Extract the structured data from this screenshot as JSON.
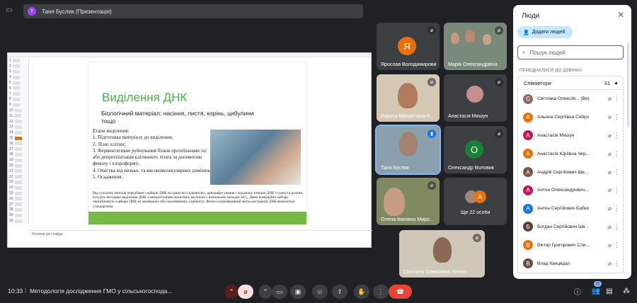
{
  "presenter_chip": {
    "initial": "Т",
    "label": "Таня Буслик (Презентація)"
  },
  "slide": {
    "title": "Виділення ДНК",
    "subtitle": "Біологічний матеріал: насіння, листя, корінь, цибулини тощо",
    "steps": [
      "Етапи виділення:",
      "1. Підготовка матеріалу до виділення;",
      "2. Лізис клітин;",
      "3. Ферментативне руйнування білків протеїназами та/або депротеїнізація клітинного лізата за допомогою фенолу і хлороформу;",
      "4. Очистка від низько- та високомолекулярних домішок;",
      "5. Осадження."
    ],
    "body": "Ряд сучасних методів передбачає сорбцію ДНК на гранулах силікагелю , центрифугування і подальшу елюцію ДНК з гранул в розчин. Існують методики виділення ДНК з використанням магнітних частинок з напиленим оксидом SiO₂. Деякі комерційні набори передбачають сорбцію ДНК на мембранах або іонообмінних сорбентах. Фенол-хлороформний метод екстракції ДНК вважається стандартним.",
    "notes_placeholder": "Нотатки до слайда",
    "thumb_numbers": [
      "1",
      "2",
      "3",
      "4",
      "5",
      "6",
      "7",
      "8",
      "9",
      "10",
      "11",
      "12",
      "13",
      "14",
      "15",
      "16",
      "17",
      "18",
      "19",
      "20",
      "21",
      "22",
      "23",
      "24",
      "25",
      "26",
      "27",
      "28",
      "29",
      "30"
    ]
  },
  "tiles": [
    {
      "name": "Ярослав Володимирович",
      "initial": "Я",
      "avatar_color": "#e8710a"
    },
    {
      "name": "Марія Олександрівна"
    },
    {
      "name": "Лариса Михайлівна К..."
    },
    {
      "name": "Анастасія Мишун"
    },
    {
      "name": "Таня Буслик"
    },
    {
      "name": "Олександр Воловик",
      "initial": "О",
      "avatar_color": "#188038"
    },
    {
      "name": "Олена Іванівна Миро..."
    },
    {
      "name": "Ще 22 особи",
      "initial": "А",
      "avatar_color": "#e8710a"
    },
    {
      "name": "Світлана Олексіївна Усенко"
    }
  ],
  "panel": {
    "title": "Люди",
    "add_label": "Додати людей",
    "search_placeholder": "Пошук людей",
    "section": "ПРИЄДНАЛИСЯ ДО ДЗВІНКА",
    "group_label": "Співавтори",
    "group_count": "31",
    "people": [
      {
        "name": "Світлана Олексіїв... (Ви)",
        "initial": "С",
        "color": "#8d6e63"
      },
      {
        "name": "Альона Сергіївна Сябро",
        "initial": "А",
        "color": "#e8710a"
      },
      {
        "name": "Анастасія Мишун",
        "initial": "А",
        "color": "#c2185b"
      },
      {
        "name": "Анастасія Юріївна Чер...",
        "initial": "А",
        "color": "#e8710a"
      },
      {
        "name": "Андрій Сергійович Ше...",
        "initial": "А",
        "color": "#795548"
      },
      {
        "name": "Антон Олександрович...",
        "initial": "А",
        "color": "#c2185b"
      },
      {
        "name": "Антон Сергійович Бабко",
        "initial": "А",
        "color": "#1a73e8"
      },
      {
        "name": "Богдан Сергійович Шв...",
        "initial": "Б",
        "color": "#5d4037"
      },
      {
        "name": "Віктор Григорович Сли...",
        "initial": "В",
        "color": "#e8710a"
      },
      {
        "name": "Влад Канцедал",
        "initial": "В",
        "color": "#6d4c41"
      }
    ]
  },
  "bottom": {
    "time": "10:33",
    "meeting": "Методологія дослідження ГМО у сільськогоспода...",
    "people_count": "31"
  }
}
